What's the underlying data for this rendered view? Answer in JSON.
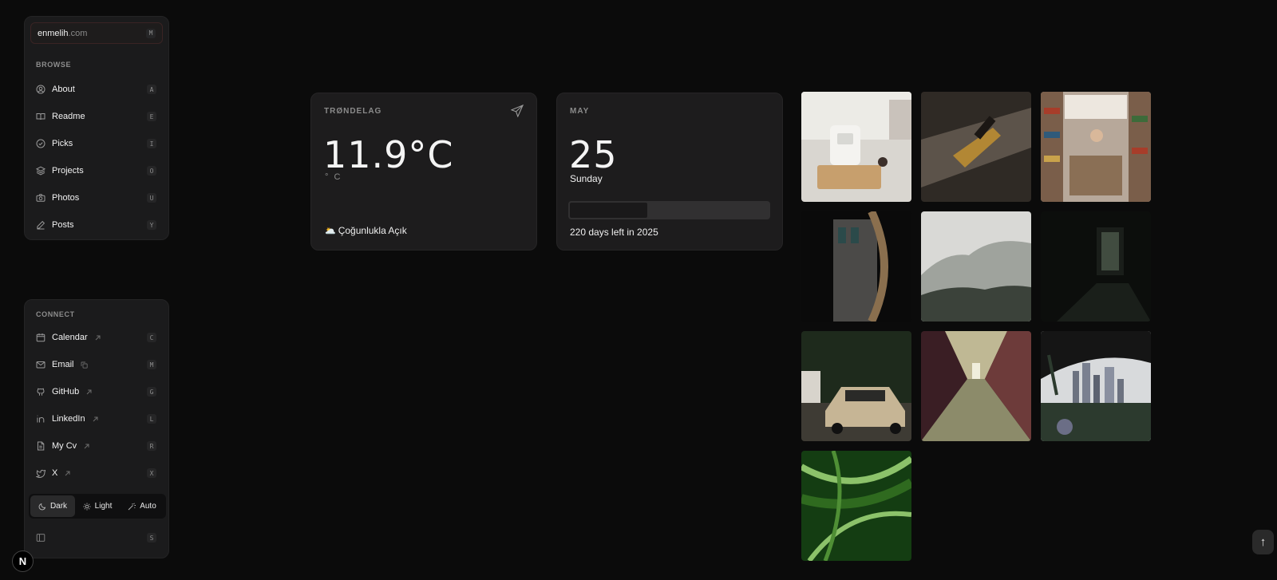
{
  "sidebar": {
    "site": {
      "domain": "enmelih",
      "tld": ".com",
      "shortcut": "M"
    },
    "browse_label": "BROWSE",
    "browse_items": [
      {
        "label": "About",
        "shortcut": "A",
        "icon": "user-circle-icon"
      },
      {
        "label": "Readme",
        "shortcut": "E",
        "icon": "book-open-icon"
      },
      {
        "label": "Picks",
        "shortcut": "I",
        "icon": "check-circle-icon"
      },
      {
        "label": "Projects",
        "shortcut": "O",
        "icon": "layers-icon"
      },
      {
        "label": "Photos",
        "shortcut": "U",
        "icon": "camera-icon"
      },
      {
        "label": "Posts",
        "shortcut": "Y",
        "icon": "pen-icon"
      }
    ],
    "connect_label": "CONNECT",
    "connect_items": [
      {
        "label": "Calendar",
        "shortcut": "C",
        "icon": "calendar-icon",
        "trail": "external-link-icon"
      },
      {
        "label": "Email",
        "shortcut": "M",
        "icon": "mail-icon",
        "trail": "copy-icon"
      },
      {
        "label": "GitHub",
        "shortcut": "G",
        "icon": "github-icon",
        "trail": "external-link-icon"
      },
      {
        "label": "LinkedIn",
        "shortcut": "L",
        "icon": "linkedin-icon",
        "trail": "external-link-icon"
      },
      {
        "label": "My Cv",
        "shortcut": "R",
        "icon": "file-icon",
        "trail": "external-link-icon"
      },
      {
        "label": "X",
        "shortcut": "X",
        "icon": "twitter-icon",
        "trail": "external-link-icon"
      }
    ],
    "theme": {
      "dark": "Dark",
      "light": "Light",
      "auto": "Auto",
      "selected": "Dark"
    },
    "collapse_shortcut": "S"
  },
  "weather": {
    "region": "TRØNDELAG",
    "temperature": "11.9°C",
    "unit": "° C",
    "condition": "Çoğunlukla Açık",
    "condition_emoji": "🌥️"
  },
  "date": {
    "month": "MAY",
    "day": "25",
    "weekday": "Sunday",
    "year_progress": 0.4,
    "days_left_text": "220 days left in 2025"
  },
  "photos": [
    {
      "name": "photo-card-terminal",
      "palette": [
        "#cfcac2",
        "#e8e5df",
        "#8a7355"
      ]
    },
    {
      "name": "photo-wine-bottle",
      "palette": [
        "#5c534a",
        "#2f2a25",
        "#c8952e"
      ]
    },
    {
      "name": "photo-bookshelf",
      "palette": [
        "#b7a89a",
        "#ede7df",
        "#7a3e2a"
      ]
    },
    {
      "name": "photo-building-arch",
      "palette": [
        "#0a0a0a",
        "#4b4a48",
        "#8a6f4e"
      ]
    },
    {
      "name": "photo-misty-mountain",
      "palette": [
        "#b7b8b5",
        "#d9d9d6",
        "#3b423a"
      ]
    },
    {
      "name": "photo-dark-room",
      "palette": [
        "#0c0e0c",
        "#1a1e1a",
        "#5c6a5a"
      ]
    },
    {
      "name": "photo-mercedes-car",
      "palette": [
        "#1e2a1c",
        "#c6b595",
        "#3e3b34"
      ]
    },
    {
      "name": "photo-graffiti-corridor",
      "palette": [
        "#3a1e24",
        "#8c8b6a",
        "#6d3b3a"
      ]
    },
    {
      "name": "photo-city-skyline",
      "palette": [
        "#d8dadc",
        "#2c3a2e",
        "#6b6e86"
      ]
    },
    {
      "name": "photo-palm-leaves",
      "palette": [
        "#2f6a1f",
        "#8cc26a",
        "#143d12"
      ]
    }
  ],
  "footer": {
    "next_badge": "N",
    "scroll_top": "↑"
  }
}
